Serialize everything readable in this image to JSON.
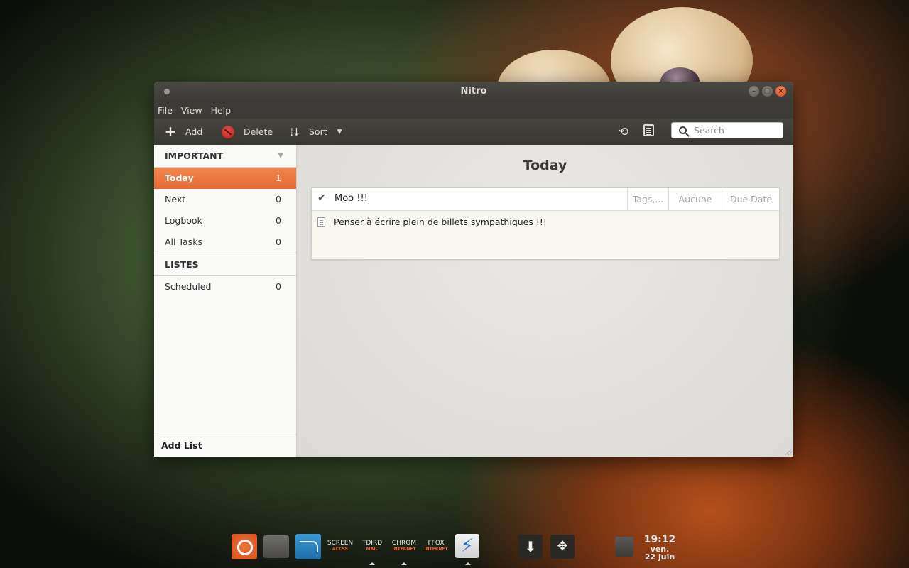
{
  "window": {
    "title": "Nitro"
  },
  "menubar": {
    "items": [
      "File",
      "View",
      "Help"
    ]
  },
  "toolbar": {
    "add_label": "Add",
    "delete_label": "Delete",
    "sort_label": "Sort",
    "search_placeholder": "Search"
  },
  "sidebar": {
    "important_header": "IMPORTANT",
    "important_items": [
      {
        "label": "Today",
        "count": "1"
      },
      {
        "label": "Next",
        "count": "0"
      },
      {
        "label": "Logbook",
        "count": "0"
      },
      {
        "label": "All Tasks",
        "count": "0"
      }
    ],
    "lists_header": "LISTES",
    "lists_items": [
      {
        "label": "Scheduled",
        "count": "0"
      }
    ],
    "add_list_label": "Add List"
  },
  "main": {
    "title": "Today",
    "task": {
      "name": "Moo !!!",
      "tags_placeholder": "Tags,...",
      "priority": "Aucune",
      "due_date": "Due Date",
      "note": "Penser à écrire plein de billets sympathiques !!!"
    }
  },
  "dock": {
    "screen": {
      "label": "SCREEN",
      "sub": "ACCSS"
    },
    "tdird": {
      "label": "TDIRD",
      "sub": "MAIL"
    },
    "chrom": {
      "label": "CHROM",
      "sub": "INTERNET"
    },
    "ffox": {
      "label": "FFOX",
      "sub": "INTERNET"
    }
  },
  "clock": {
    "time": "19:12",
    "day": "ven.",
    "date": "22 juin"
  },
  "colors": {
    "accent": "#ef7d43",
    "titlebar": "#3c3b37",
    "close": "#e05a28"
  }
}
